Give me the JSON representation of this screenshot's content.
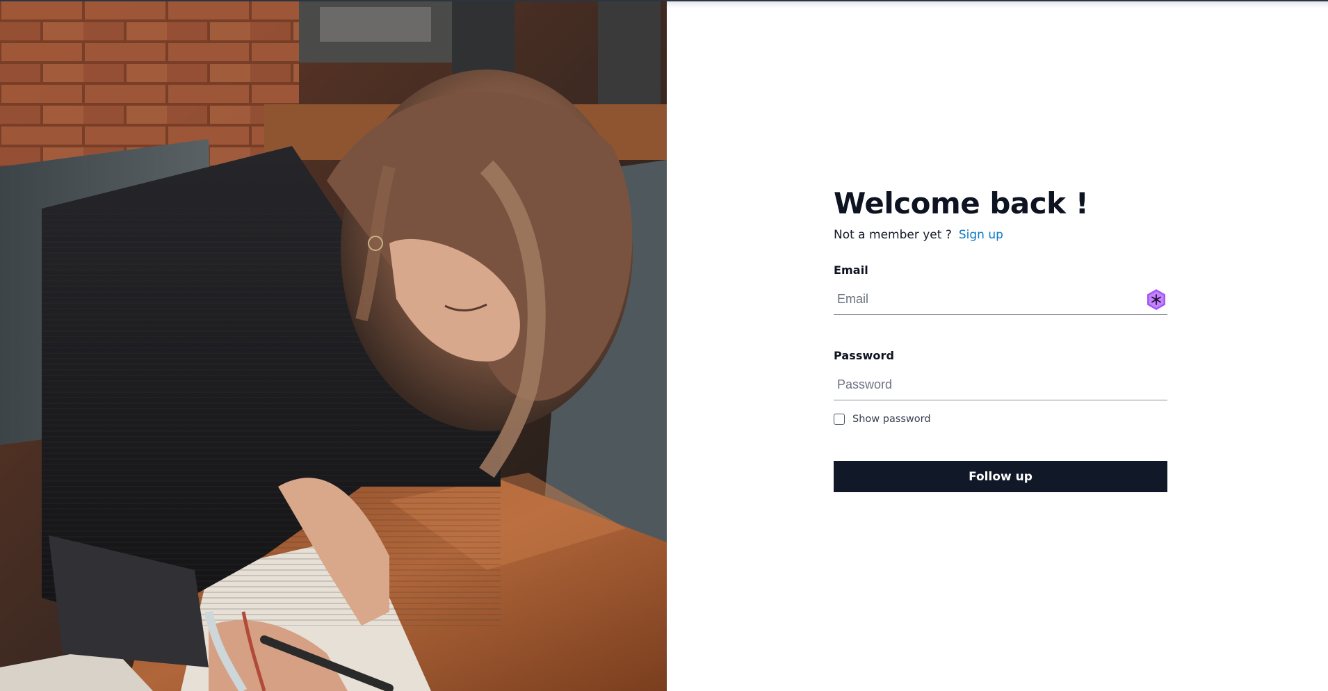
{
  "hero": {
    "image_alt": "Woman writing in a notebook at a café table"
  },
  "login": {
    "title": "Welcome back !",
    "not_member_text": "Not a member yet ?",
    "signup_link": "Sign up",
    "email_label": "Email",
    "email_placeholder": "Email",
    "email_value": "",
    "password_label": "Password",
    "password_placeholder": "Password",
    "password_value": "",
    "show_password_label": "Show password",
    "show_password_checked": false,
    "submit_label": "Follow up"
  },
  "icons": {
    "autofill": "password-manager-icon"
  },
  "colors": {
    "accent_link": "#0b78c8",
    "button_bg": "#111827",
    "text_dark": "#0d1321",
    "autofill_icon": "#a855f7"
  }
}
